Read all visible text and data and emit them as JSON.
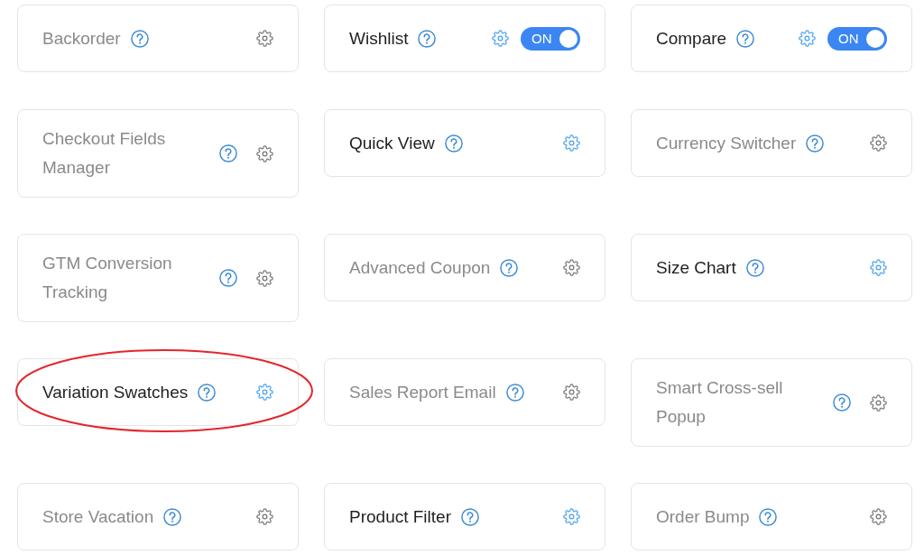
{
  "features": [
    {
      "title": "Backorder",
      "active": false,
      "circled": false
    },
    {
      "title": "Wishlist",
      "active": true,
      "circled": false,
      "toggle": {
        "on": true,
        "label": "ON"
      }
    },
    {
      "title": "Compare",
      "active": true,
      "circled": false,
      "toggle": {
        "on": true,
        "label": "ON"
      }
    },
    {
      "title": "Checkout Fields Manager",
      "active": false,
      "circled": false
    },
    {
      "title": "Quick View",
      "active": true,
      "circled": false
    },
    {
      "title": "Currency Switcher",
      "active": false,
      "circled": false
    },
    {
      "title": "GTM Conversion Tracking",
      "active": false,
      "circled": false
    },
    {
      "title": "Advanced Coupon",
      "active": false,
      "circled": false
    },
    {
      "title": "Size Chart",
      "active": true,
      "circled": false
    },
    {
      "title": "Variation Swatches",
      "active": true,
      "circled": true
    },
    {
      "title": "Sales Report Email",
      "active": false,
      "circled": false
    },
    {
      "title": "Smart Cross-sell Popup",
      "active": false,
      "circled": false
    },
    {
      "title": "Store Vacation",
      "active": false,
      "circled": false
    },
    {
      "title": "Product Filter",
      "active": true,
      "circled": false
    },
    {
      "title": "Order Bump",
      "active": false,
      "circled": false
    }
  ]
}
